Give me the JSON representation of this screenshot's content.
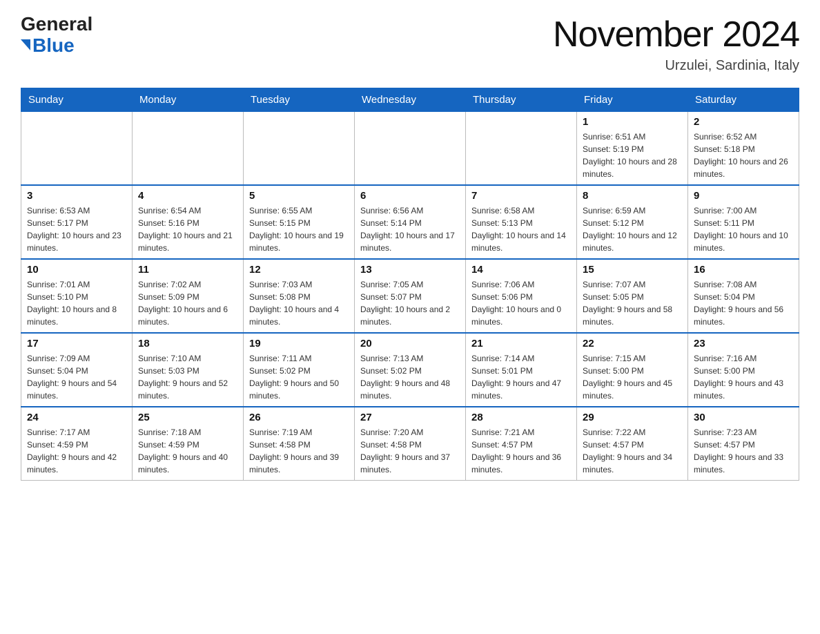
{
  "header": {
    "logo_general": "General",
    "logo_blue": "Blue",
    "title": "November 2024",
    "subtitle": "Urzulei, Sardinia, Italy"
  },
  "weekdays": [
    "Sunday",
    "Monday",
    "Tuesday",
    "Wednesday",
    "Thursday",
    "Friday",
    "Saturday"
  ],
  "weeks": [
    [
      {
        "day": "",
        "sunrise": "",
        "sunset": "",
        "daylight": ""
      },
      {
        "day": "",
        "sunrise": "",
        "sunset": "",
        "daylight": ""
      },
      {
        "day": "",
        "sunrise": "",
        "sunset": "",
        "daylight": ""
      },
      {
        "day": "",
        "sunrise": "",
        "sunset": "",
        "daylight": ""
      },
      {
        "day": "",
        "sunrise": "",
        "sunset": "",
        "daylight": ""
      },
      {
        "day": "1",
        "sunrise": "Sunrise: 6:51 AM",
        "sunset": "Sunset: 5:19 PM",
        "daylight": "Daylight: 10 hours and 28 minutes."
      },
      {
        "day": "2",
        "sunrise": "Sunrise: 6:52 AM",
        "sunset": "Sunset: 5:18 PM",
        "daylight": "Daylight: 10 hours and 26 minutes."
      }
    ],
    [
      {
        "day": "3",
        "sunrise": "Sunrise: 6:53 AM",
        "sunset": "Sunset: 5:17 PM",
        "daylight": "Daylight: 10 hours and 23 minutes."
      },
      {
        "day": "4",
        "sunrise": "Sunrise: 6:54 AM",
        "sunset": "Sunset: 5:16 PM",
        "daylight": "Daylight: 10 hours and 21 minutes."
      },
      {
        "day": "5",
        "sunrise": "Sunrise: 6:55 AM",
        "sunset": "Sunset: 5:15 PM",
        "daylight": "Daylight: 10 hours and 19 minutes."
      },
      {
        "day": "6",
        "sunrise": "Sunrise: 6:56 AM",
        "sunset": "Sunset: 5:14 PM",
        "daylight": "Daylight: 10 hours and 17 minutes."
      },
      {
        "day": "7",
        "sunrise": "Sunrise: 6:58 AM",
        "sunset": "Sunset: 5:13 PM",
        "daylight": "Daylight: 10 hours and 14 minutes."
      },
      {
        "day": "8",
        "sunrise": "Sunrise: 6:59 AM",
        "sunset": "Sunset: 5:12 PM",
        "daylight": "Daylight: 10 hours and 12 minutes."
      },
      {
        "day": "9",
        "sunrise": "Sunrise: 7:00 AM",
        "sunset": "Sunset: 5:11 PM",
        "daylight": "Daylight: 10 hours and 10 minutes."
      }
    ],
    [
      {
        "day": "10",
        "sunrise": "Sunrise: 7:01 AM",
        "sunset": "Sunset: 5:10 PM",
        "daylight": "Daylight: 10 hours and 8 minutes."
      },
      {
        "day": "11",
        "sunrise": "Sunrise: 7:02 AM",
        "sunset": "Sunset: 5:09 PM",
        "daylight": "Daylight: 10 hours and 6 minutes."
      },
      {
        "day": "12",
        "sunrise": "Sunrise: 7:03 AM",
        "sunset": "Sunset: 5:08 PM",
        "daylight": "Daylight: 10 hours and 4 minutes."
      },
      {
        "day": "13",
        "sunrise": "Sunrise: 7:05 AM",
        "sunset": "Sunset: 5:07 PM",
        "daylight": "Daylight: 10 hours and 2 minutes."
      },
      {
        "day": "14",
        "sunrise": "Sunrise: 7:06 AM",
        "sunset": "Sunset: 5:06 PM",
        "daylight": "Daylight: 10 hours and 0 minutes."
      },
      {
        "day": "15",
        "sunrise": "Sunrise: 7:07 AM",
        "sunset": "Sunset: 5:05 PM",
        "daylight": "Daylight: 9 hours and 58 minutes."
      },
      {
        "day": "16",
        "sunrise": "Sunrise: 7:08 AM",
        "sunset": "Sunset: 5:04 PM",
        "daylight": "Daylight: 9 hours and 56 minutes."
      }
    ],
    [
      {
        "day": "17",
        "sunrise": "Sunrise: 7:09 AM",
        "sunset": "Sunset: 5:04 PM",
        "daylight": "Daylight: 9 hours and 54 minutes."
      },
      {
        "day": "18",
        "sunrise": "Sunrise: 7:10 AM",
        "sunset": "Sunset: 5:03 PM",
        "daylight": "Daylight: 9 hours and 52 minutes."
      },
      {
        "day": "19",
        "sunrise": "Sunrise: 7:11 AM",
        "sunset": "Sunset: 5:02 PM",
        "daylight": "Daylight: 9 hours and 50 minutes."
      },
      {
        "day": "20",
        "sunrise": "Sunrise: 7:13 AM",
        "sunset": "Sunset: 5:02 PM",
        "daylight": "Daylight: 9 hours and 48 minutes."
      },
      {
        "day": "21",
        "sunrise": "Sunrise: 7:14 AM",
        "sunset": "Sunset: 5:01 PM",
        "daylight": "Daylight: 9 hours and 47 minutes."
      },
      {
        "day": "22",
        "sunrise": "Sunrise: 7:15 AM",
        "sunset": "Sunset: 5:00 PM",
        "daylight": "Daylight: 9 hours and 45 minutes."
      },
      {
        "day": "23",
        "sunrise": "Sunrise: 7:16 AM",
        "sunset": "Sunset: 5:00 PM",
        "daylight": "Daylight: 9 hours and 43 minutes."
      }
    ],
    [
      {
        "day": "24",
        "sunrise": "Sunrise: 7:17 AM",
        "sunset": "Sunset: 4:59 PM",
        "daylight": "Daylight: 9 hours and 42 minutes."
      },
      {
        "day": "25",
        "sunrise": "Sunrise: 7:18 AM",
        "sunset": "Sunset: 4:59 PM",
        "daylight": "Daylight: 9 hours and 40 minutes."
      },
      {
        "day": "26",
        "sunrise": "Sunrise: 7:19 AM",
        "sunset": "Sunset: 4:58 PM",
        "daylight": "Daylight: 9 hours and 39 minutes."
      },
      {
        "day": "27",
        "sunrise": "Sunrise: 7:20 AM",
        "sunset": "Sunset: 4:58 PM",
        "daylight": "Daylight: 9 hours and 37 minutes."
      },
      {
        "day": "28",
        "sunrise": "Sunrise: 7:21 AM",
        "sunset": "Sunset: 4:57 PM",
        "daylight": "Daylight: 9 hours and 36 minutes."
      },
      {
        "day": "29",
        "sunrise": "Sunrise: 7:22 AM",
        "sunset": "Sunset: 4:57 PM",
        "daylight": "Daylight: 9 hours and 34 minutes."
      },
      {
        "day": "30",
        "sunrise": "Sunrise: 7:23 AM",
        "sunset": "Sunset: 4:57 PM",
        "daylight": "Daylight: 9 hours and 33 minutes."
      }
    ]
  ]
}
